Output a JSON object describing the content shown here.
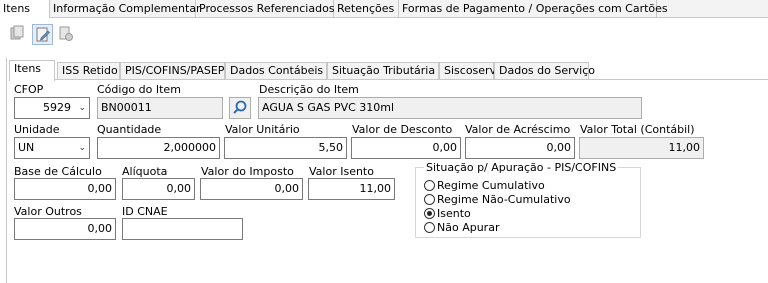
{
  "top_tabs": [
    "Itens",
    "Informação Complementar",
    "Processos Referenciados",
    "Retenções",
    "Formas de Pagamento / Operações com Cartões"
  ],
  "sub_tabs": [
    "Itens",
    "ISS Retido",
    "PIS/COFINS/PASEP",
    "Dados Contábeis",
    "Situação Tributária",
    "Siscoserv",
    "Dados do Serviço"
  ],
  "toolbar": {
    "icons": [
      "new-item-icon",
      "edit-item-icon",
      "delete-item-icon"
    ]
  },
  "form": {
    "cfop": {
      "label": "CFOP",
      "value": "5929"
    },
    "codigo": {
      "label": "Código do Item",
      "value": "BN00011"
    },
    "descricao": {
      "label": "Descrição do Item",
      "value": "AGUA S GAS PVC 310ml"
    },
    "unidade": {
      "label": "Unidade",
      "value": "UN"
    },
    "quantidade": {
      "label": "Quantidade",
      "value": "2,000000"
    },
    "valor_unitario": {
      "label": "Valor Unitário",
      "value": "5,50"
    },
    "valor_desconto": {
      "label": "Valor de Desconto",
      "value": "0,00"
    },
    "valor_acrescimo": {
      "label": "Valor de Acréscimo",
      "value": "0,00"
    },
    "valor_total": {
      "label": "Valor Total (Contábil)",
      "value": "11,00"
    },
    "base_calculo": {
      "label": "Base de Cálculo",
      "value": "0,00"
    },
    "aliquota": {
      "label": "Alíquota",
      "value": "0,00"
    },
    "valor_imposto": {
      "label": "Valor do Imposto",
      "value": "0,00"
    },
    "valor_isento": {
      "label": "Valor Isento",
      "value": "11,00"
    },
    "valor_outros": {
      "label": "Valor Outros",
      "value": "0,00"
    },
    "id_cnae": {
      "label": "ID CNAE",
      "value": ""
    }
  },
  "situacao": {
    "title": "Situação p/ Apuração - PIS/COFINS",
    "options": [
      "Regime Cumulativo",
      "Regime Não-Cumulativo",
      "Isento",
      "Não Apurar"
    ],
    "selected": "Isento"
  }
}
